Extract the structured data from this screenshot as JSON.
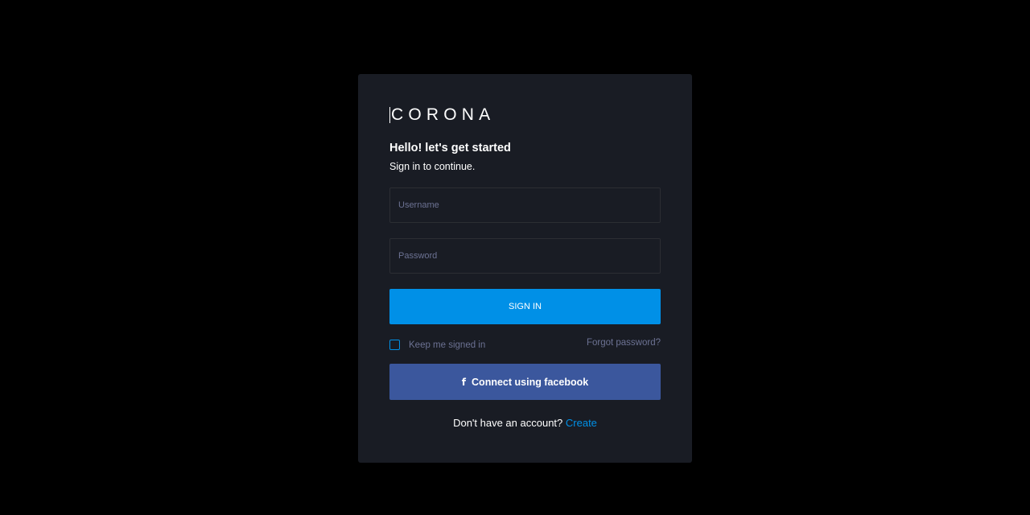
{
  "logo": {
    "text": "CORONA"
  },
  "heading": {
    "title": "Hello! let's get started",
    "subtitle": "Sign in to continue."
  },
  "form": {
    "username_placeholder": "Username",
    "password_placeholder": "Password",
    "signin_label": "SIGN IN",
    "remember_label": "Keep me signed in",
    "remember_checked": false,
    "forgot_label": "Forgot password?",
    "facebook_icon": "facebook-f-icon",
    "facebook_label": "Connect using facebook"
  },
  "signup": {
    "prompt": "Don't have an account?",
    "link_label": "Create"
  },
  "colors": {
    "page_bg": "#000000",
    "card_bg": "#191c24",
    "primary": "#0090e7",
    "facebook": "#3b579d",
    "muted_text": "#6c7293",
    "input_border": "#2c2e33"
  }
}
